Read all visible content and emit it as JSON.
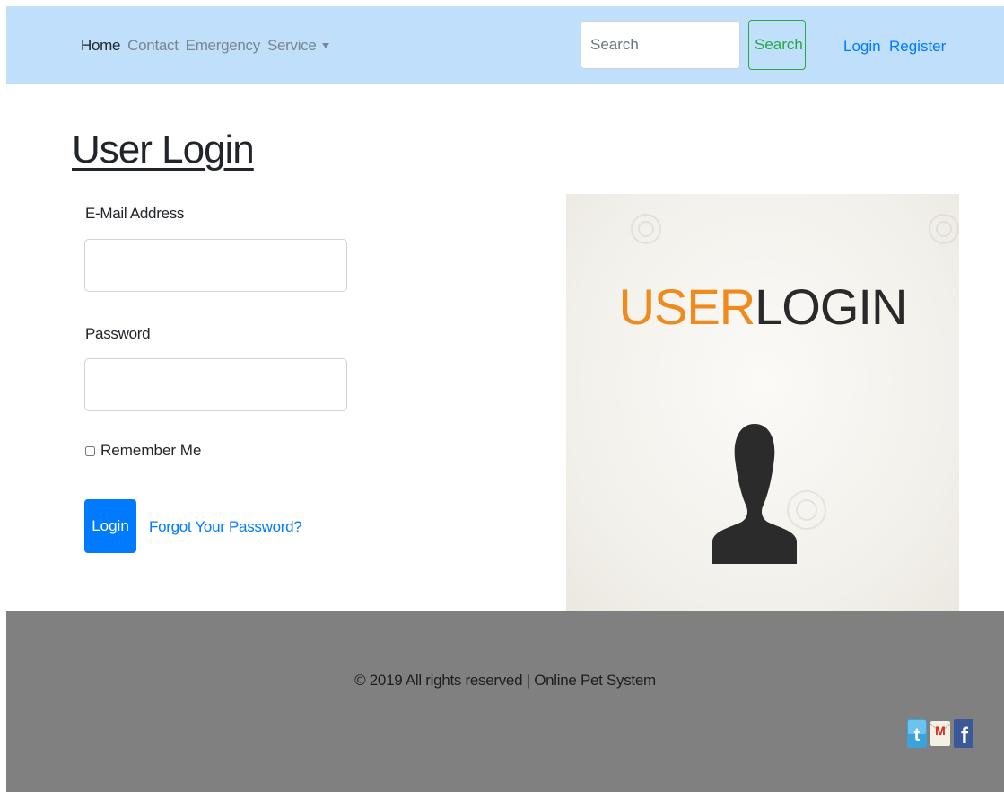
{
  "nav": {
    "items": [
      {
        "label": "Home",
        "active": true
      },
      {
        "label": "Contact",
        "active": false
      },
      {
        "label": "Emergency",
        "active": false
      },
      {
        "label": "Service",
        "active": false
      }
    ],
    "search_placeholder": "Search",
    "search_button": "Search",
    "login": "Login",
    "register": "Register"
  },
  "main": {
    "title": "User Login",
    "email_label": "E-Mail Address",
    "email_value": "",
    "password_label": "Password",
    "password_value": "",
    "remember_label": "Remember Me",
    "remember_checked": false,
    "login_button": "Login",
    "forgot_link": "Forgot Your Password?"
  },
  "image": {
    "word_user": "USER",
    "word_login": "LOGIN"
  },
  "footer": {
    "copyright": "© 2019 All rights reserved | Online Pet System",
    "social": [
      "twitter-icon",
      "gmail-icon",
      "facebook-icon"
    ]
  },
  "colors": {
    "navbar_bg": "#bfdffb",
    "primary": "#007bff",
    "success": "#28a745",
    "footer_bg": "#808080",
    "accent_orange": "#f08a1c"
  }
}
